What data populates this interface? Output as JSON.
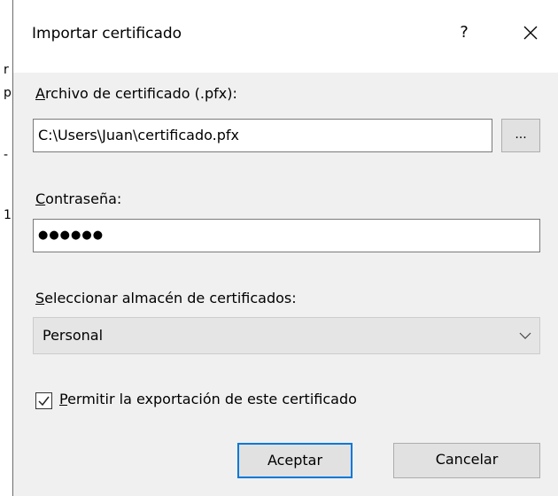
{
  "dialog": {
    "title": "Importar certificado",
    "help_label": "?",
    "close_icon": "close-icon"
  },
  "backdrop": {
    "glyphs": [
      "r",
      "p",
      "-",
      "1"
    ]
  },
  "file": {
    "label_accel": "A",
    "label_rest": "rchivo de certificado (.pfx):",
    "value": "C:\\Users\\Juan\\certificado.pfx",
    "browse_label": "..."
  },
  "password": {
    "label_accel": "C",
    "label_rest": "ontraseña:",
    "masked_value": "●●●●●●"
  },
  "store": {
    "label_accel": "S",
    "label_rest": "eleccionar almacén de certificados:",
    "selected": "Personal",
    "chevron_icon": "chevron-down-icon"
  },
  "export": {
    "checked": true,
    "label_accel": "P",
    "label_rest": "ermitir la exportación de este certificado"
  },
  "buttons": {
    "ok_label": "Aceptar",
    "cancel_label": "Cancelar"
  }
}
